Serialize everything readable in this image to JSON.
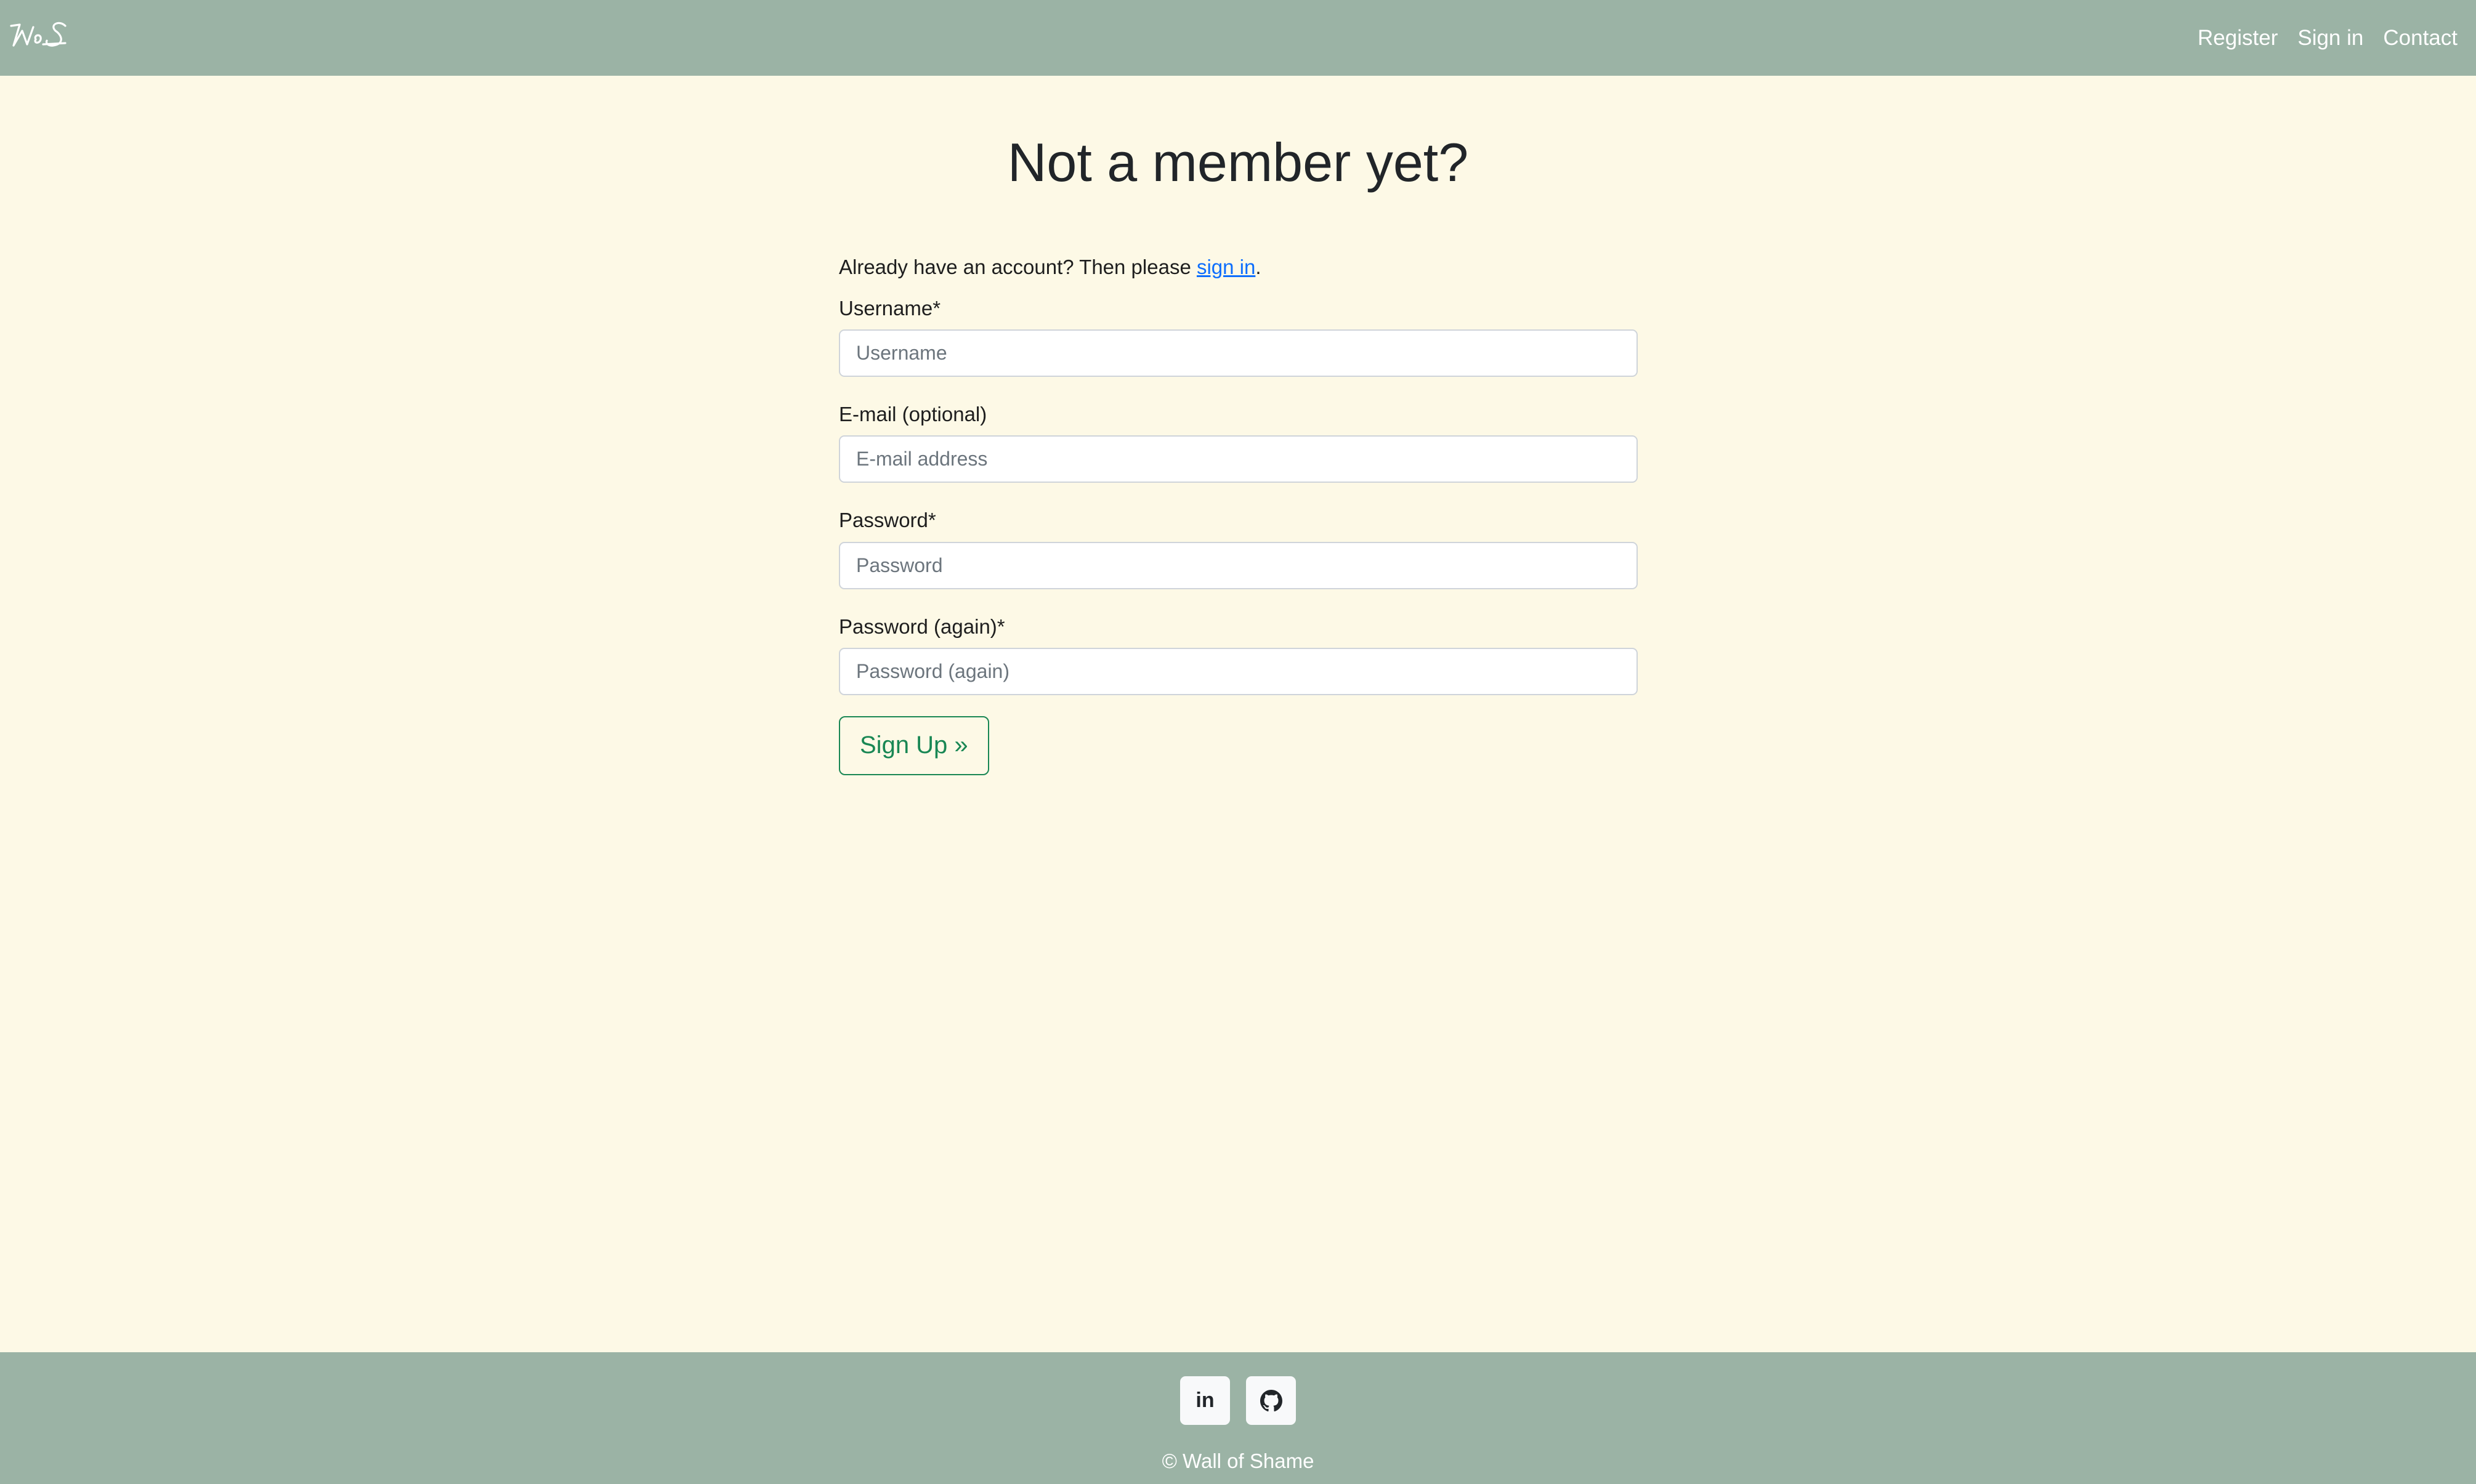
{
  "header": {
    "logo_icon": "wos-handwritten-logo",
    "nav": [
      "Register",
      "Sign in",
      "Contact"
    ]
  },
  "main": {
    "title": "Not a member yet?",
    "intro_prefix": "Already have an account? Then please ",
    "intro_link": "sign in",
    "intro_suffix": ".",
    "fields": [
      {
        "label": "Username*",
        "placeholder": "Username",
        "value": ""
      },
      {
        "label": "E-mail (optional)",
        "placeholder": "E-mail address",
        "value": ""
      },
      {
        "label": "Password*",
        "placeholder": "Password",
        "value": ""
      },
      {
        "label": "Password (again)*",
        "placeholder": "Password (again)",
        "value": ""
      }
    ],
    "submit_label": "Sign Up »"
  },
  "footer": {
    "social": [
      {
        "icon": "linkedin-icon",
        "glyph": "in"
      },
      {
        "icon": "github-icon"
      }
    ],
    "copyright": "© Wall of Shame"
  },
  "colors": {
    "navbar": "#9bb3a5",
    "background": "#fdf9e6",
    "accent": "#198754",
    "link": "#0d6efd"
  }
}
